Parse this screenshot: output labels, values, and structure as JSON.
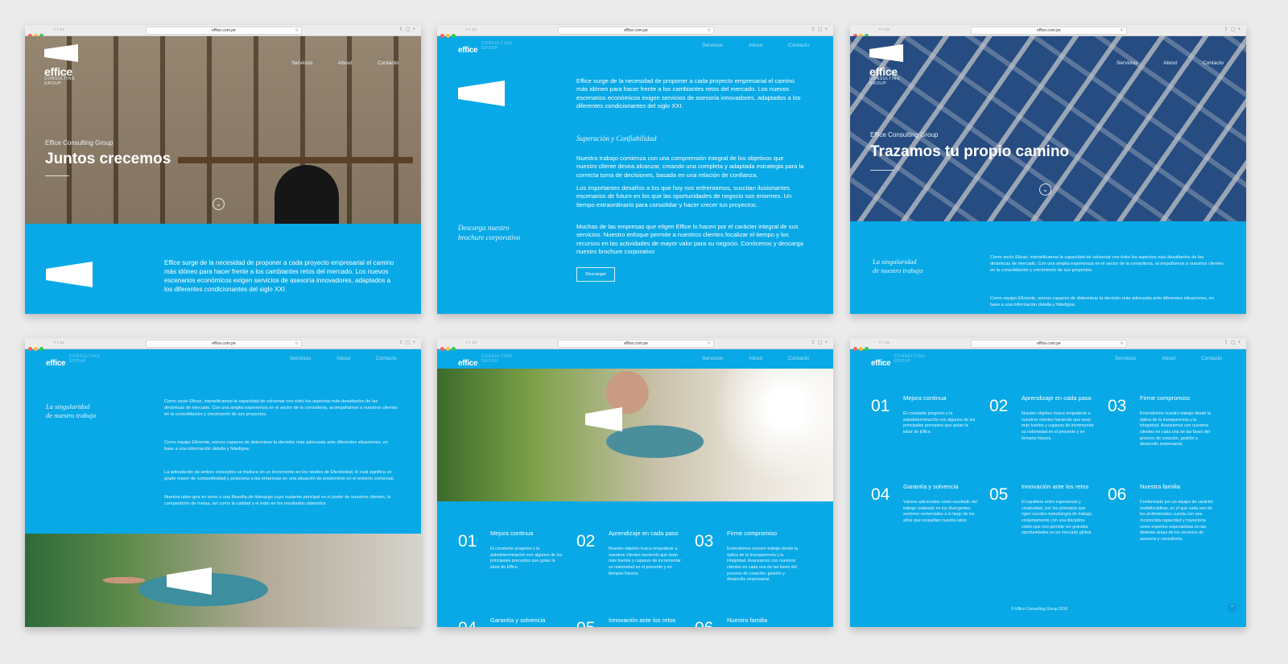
{
  "browser": {
    "url": "effice.com.pe"
  },
  "brand": {
    "name": "effice",
    "sub1": "CONSULTING",
    "sub2": "GROUP",
    "sub_inline": "CONSULTING GROUP"
  },
  "nav": [
    "Servicios",
    "About",
    "Contacto"
  ],
  "screen1": {
    "kicker": "Effice Consulting Group",
    "title": "Juntos crecemos",
    "intro": "Effice surge de la necesidad de proponer a cada proyecto empresarial el camino más idóneo para hacer frente a los cambiantes retos del mercado. Los nuevos escenarios económicos exigen servicios de asesoría innovadores, adaptados a los diferentes condicionantes del siglo XXI."
  },
  "screen2": {
    "intro": "Effice surge de la necesidad de proponer a cada proyecto empresarial el camino más idóneo para hacer frente a los cambiantes retos del mercado. Los nuevos escenarios económicos exigen servicios de asesoría innovadores, adaptados a los diferentes condicionantes del siglo XXI.",
    "subtitle": "Superación y Confiabilidad",
    "p1": "Nuestro trabajo comienza con una comprensión integral de los objetivos que nuestro cliente desea alcanzar, creando una completa y adaptada estrategia para la correcta toma de decisiones, basada en una relación de confianza.",
    "p2": "Los importantes desafíos a los que hoy nos enfrentamos, suscitan ilusionantes escenarios de futuro en los que las oportunidades de negocio son enormes. Un tiempo extraordinario para consolidar y hacer crecer tus proyectos.",
    "p3": "Muchas de las empresas que eligen Effice lo hacen por el carácter integral de sus servicios. Nuestro enfoque permite a nuestros clientes focalizar el tiempo y los recursos en las actividades de mayor valor para su negocio. Conócenos y descarga nuestro brochure corporativo",
    "download_label1": "Descarga nuestro",
    "download_label2": "brochure corporativo",
    "download_button": "Descargar"
  },
  "screen3": {
    "kicker": "Effice Consulting Group",
    "title": "Trazamos tu propio camino",
    "side1": "La singularidad",
    "side2": "de nuestro trabajo",
    "p1": "Como socio Eficaz, intensificamos la capacidad de solventar con éxito los aspectos más desafiantes de las dinámicas de mercado. Con una amplia experiencia en el sector de la consultoría, acompañamos a nuestros clientes en la consolidación y crecimiento de sus proyectos.",
    "p2": "Como equipo Eficiente, somos capaces de determinar la decisión más adecuada ante diferentes situaciones, en base a una información detalla y fidedigna."
  },
  "screen4": {
    "side1": "La singularidad",
    "side2": "de nuestro trabajo",
    "p1": "Como socio Eficaz, intensificamos la capacidad de solventar con éxito los aspectos más desafiantes de las dinámicas de mercado. Con una amplia experiencia en el sector de la consultoría, acompañamos a nuestros clientes en la consolidación y crecimiento de sus proyectos.",
    "p2": "Como equipo Eficiente, somos capaces de determinar la decisión más adecuada ante diferentes situaciones, en base a una información detalla y fidedigna.",
    "p3": "La articulación de ambos conceptos se traduce en un incremento en los niveles de Efectividad, lo cual significa un grado mayor de competitividad y posiciona a las empresas en una situación de predominio en el entorno comercial.",
    "p4": "Nuestra labor gira en torno a una filosofía de liderazgo cuyo sustento principal es el poder de nuestros clientes, la compartición de metas, así como la calidad y el éxito en los resultados obtenidos."
  },
  "features": [
    {
      "num": "01",
      "title": "Mejora continua",
      "text": "El constante progreso y la autodeterminación son algunos de los principales preceptos que guían la labor de Effice."
    },
    {
      "num": "02",
      "title": "Aprendizaje en cada paso",
      "text": "Nuestro objetivo busca empoderar a nuestros clientes haciendo que sean más fuertes y capaces de incrementar su notoriedad en el presente y en tiempos futuros."
    },
    {
      "num": "03",
      "title": "Firme compromiso",
      "text": "Entendemos nuestro trabajo desde la óptica de la transparencia y la integridad. Avanzamos con nuestros clientes en cada una de las fases del proceso de creación, gestión y desarrollo empresarial."
    },
    {
      "num": "04",
      "title": "Garantía y solvencia",
      "text": "Valores adicionales como resultado del trabajo realizado en los divergentes sectores comerciales a lo largo de los años que respaldan nuestra labor."
    },
    {
      "num": "05",
      "title": "Innovación ante los retos",
      "text": "El equilibrio entre experiencia y creatividad, son los principios que rigen nuestra metodología de trabajo, conjuntamente con una disciplina visión que nos permite ver grandes oportunidades en un mercado global."
    },
    {
      "num": "06",
      "title": "Nuestra familia",
      "text": "Conformado por un equipo de carácter multidisciplinar, en el que cada uno de los profesionales cuenta con una reconocida capacidad y trayectoria como expertos especialistas en las distintas áreas de los servicios de asesoría y consultoría."
    }
  ],
  "footer": {
    "copyright": "© Effice Consulting Group 2016"
  },
  "colors": {
    "brand_blue": "#08a9e6",
    "page_bg": "#ebebeb"
  }
}
